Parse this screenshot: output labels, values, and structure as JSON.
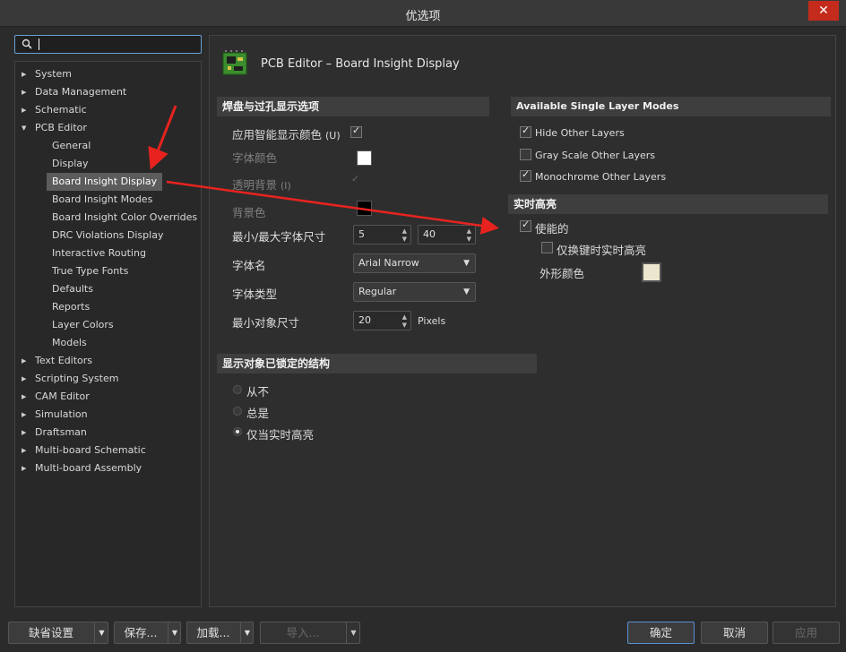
{
  "window": {
    "title": "优选项",
    "close_glyph": "✕"
  },
  "search": {
    "value": ""
  },
  "tree": [
    {
      "label": "System",
      "level": 0
    },
    {
      "label": "Data Management",
      "level": 0
    },
    {
      "label": "Schematic",
      "level": 0
    },
    {
      "label": "PCB Editor",
      "level": 0,
      "expanded": true
    },
    {
      "label": "General",
      "level": 1
    },
    {
      "label": "Display",
      "level": 1
    },
    {
      "label": "Board Insight Display",
      "level": 1,
      "selected": true
    },
    {
      "label": "Board Insight Modes",
      "level": 1
    },
    {
      "label": "Board Insight Color Overrides",
      "level": 1
    },
    {
      "label": "DRC Violations Display",
      "level": 1
    },
    {
      "label": "Interactive Routing",
      "level": 1
    },
    {
      "label": "True Type Fonts",
      "level": 1
    },
    {
      "label": "Defaults",
      "level": 1
    },
    {
      "label": "Reports",
      "level": 1
    },
    {
      "label": "Layer Colors",
      "level": 1
    },
    {
      "label": "Models",
      "level": 1
    },
    {
      "label": "Text Editors",
      "level": 0
    },
    {
      "label": "Scripting System",
      "level": 0
    },
    {
      "label": "CAM Editor",
      "level": 0
    },
    {
      "label": "Simulation",
      "level": 0
    },
    {
      "label": "Draftsman",
      "level": 0
    },
    {
      "label": "Multi-board Schematic",
      "level": 0
    },
    {
      "label": "Multi-board Assembly",
      "level": 0
    }
  ],
  "page": {
    "title": "PCB Editor – Board Insight Display",
    "icon": "pcb-board-icon"
  },
  "pad_via": {
    "header": "焊盘与过孔显示选项",
    "smart_color": {
      "label": "应用智能显示颜色",
      "accel": "(U)",
      "checked": true
    },
    "font_color": {
      "label": "字体颜色",
      "color": "#ffffff"
    },
    "transparent_bg": {
      "label": "透明背景",
      "accel": "(I)",
      "checked": true
    },
    "bg_color": {
      "label": "背景色",
      "color": "#000000"
    },
    "font_size": {
      "label": "最小/最大字体尺寸",
      "min": "5",
      "max": "40"
    },
    "font_name": {
      "label": "字体名",
      "value": "Arial Narrow"
    },
    "font_style": {
      "label": "字体类型",
      "value": "Regular"
    },
    "min_object": {
      "label": "最小对象尺寸",
      "value": "20",
      "unit": "Pixels"
    }
  },
  "locked": {
    "header": "显示对象已锁定的结构",
    "options": [
      {
        "label": "从不",
        "selected": false
      },
      {
        "label": "总是",
        "selected": false
      },
      {
        "label": "仅当实时高亮",
        "selected": true
      }
    ]
  },
  "single_layer": {
    "header": "Available Single Layer Modes",
    "options": [
      {
        "label": "Hide Other Layers",
        "checked": true
      },
      {
        "label": "Gray Scale Other Layers",
        "checked": false
      },
      {
        "label": "Monochrome Other Layers",
        "checked": true
      }
    ]
  },
  "live_highlight": {
    "header": "实时高亮",
    "enabled": {
      "label": "使能的",
      "checked": true
    },
    "on_key": {
      "label": "仅换键时实时高亮",
      "checked": false
    },
    "outline_color": {
      "label": "外形颜色",
      "color": "#ece6cf"
    }
  },
  "buttons": {
    "defaults": "缺省设置",
    "save": "保存...",
    "load": "加载...",
    "import": "导入...",
    "ok": "确定",
    "cancel": "取消",
    "apply": "应用"
  },
  "annotations": {
    "color": "#e8231f"
  }
}
